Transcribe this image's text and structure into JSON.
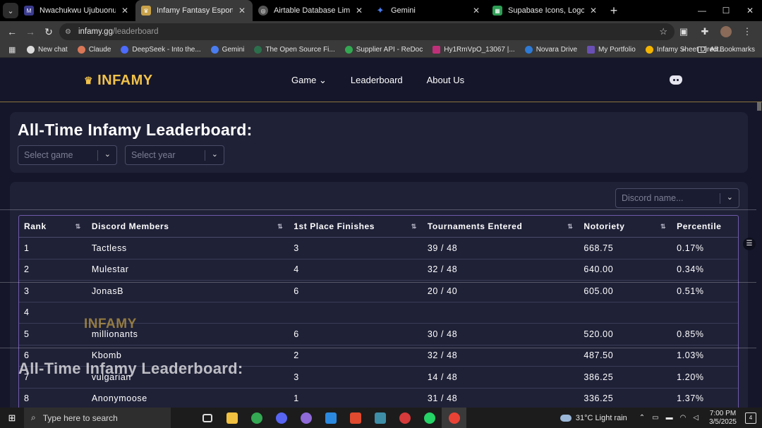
{
  "browser": {
    "tabs": [
      {
        "title": "Nwachukwu Ujubuonu",
        "favicon_color": "#3b3b8f",
        "active": false
      },
      {
        "title": "Infamy Fantasy Esports - Premie",
        "favicon_color": "#c9a24a",
        "active": true
      },
      {
        "title": "Airtable Database Limitations",
        "favicon_color": "#555555",
        "active": false
      },
      {
        "title": "Gemini",
        "favicon_color": "#4a7df0",
        "active": false
      },
      {
        "title": "Supabase Icons, Logos, Symbol",
        "favicon_color": "#2e9e55",
        "active": false
      }
    ],
    "url_host": "infamy.gg",
    "url_path": "/leaderboard",
    "bookmarks": [
      {
        "label": "New chat",
        "color": "#dcdcdc"
      },
      {
        "label": "Claude",
        "color": "#d97757"
      },
      {
        "label": "DeepSeek - Into the...",
        "color": "#4d6bfe"
      },
      {
        "label": "Gemini",
        "color": "#4a7df0"
      },
      {
        "label": "The Open Source Fi...",
        "color": "#2c6f4d"
      },
      {
        "label": "Supplier API - ReDoc",
        "color": "#33a852"
      },
      {
        "label": "Hy1RmVpO_13067 |...",
        "color": "#c0307a"
      },
      {
        "label": "Novara Drive",
        "color": "#2d7bd6"
      },
      {
        "label": "My Portfolio",
        "color": "#6a4fb5"
      },
      {
        "label": "Infamy Sheet Direct...",
        "color": "#f4b400"
      }
    ],
    "all_bookmarks_label": "All Bookmarks"
  },
  "site": {
    "logo": "INFAMY",
    "nav": [
      {
        "label": "Game ⌄"
      },
      {
        "label": "Leaderboard"
      },
      {
        "label": "About Us"
      }
    ],
    "page_title": "All-Time Infamy Leaderboard:",
    "select_game_placeholder": "Select game",
    "select_year_placeholder": "Select year",
    "discord_name_placeholder": "Discord name...",
    "accent_color": "#f1c24a"
  },
  "table": {
    "columns": [
      "Rank",
      "Discord Members",
      "1st Place Finishes",
      "Tournaments Entered",
      "Notoriety",
      "Percentile"
    ],
    "rows": [
      [
        "1",
        "Tactless",
        "3",
        "39 / 48",
        "668.75",
        "0.17%"
      ],
      [
        "2",
        "Mulestar",
        "4",
        "32 / 48",
        "640.00",
        "0.34%"
      ],
      [
        "3",
        "JonasB",
        "6",
        "20 / 40",
        "605.00",
        "0.51%"
      ],
      [
        "4",
        "",
        "",
        "",
        "",
        ""
      ],
      [
        "5",
        "millionants",
        "6",
        "30 / 48",
        "520.00",
        "0.85%"
      ],
      [
        "6",
        "Kbomb",
        "2",
        "32 / 48",
        "487.50",
        "1.03%"
      ],
      [
        "7",
        "vulgarian",
        "3",
        "14 / 48",
        "386.25",
        "1.20%"
      ],
      [
        "8",
        "Anonymoose",
        "1",
        "31 / 48",
        "336.25",
        "1.37%"
      ]
    ]
  },
  "taskbar": {
    "search_placeholder": "Type here to search",
    "weather": "31°C  Light rain",
    "time": "7:00 PM",
    "date": "3/5/2025",
    "notification_count": "4"
  }
}
